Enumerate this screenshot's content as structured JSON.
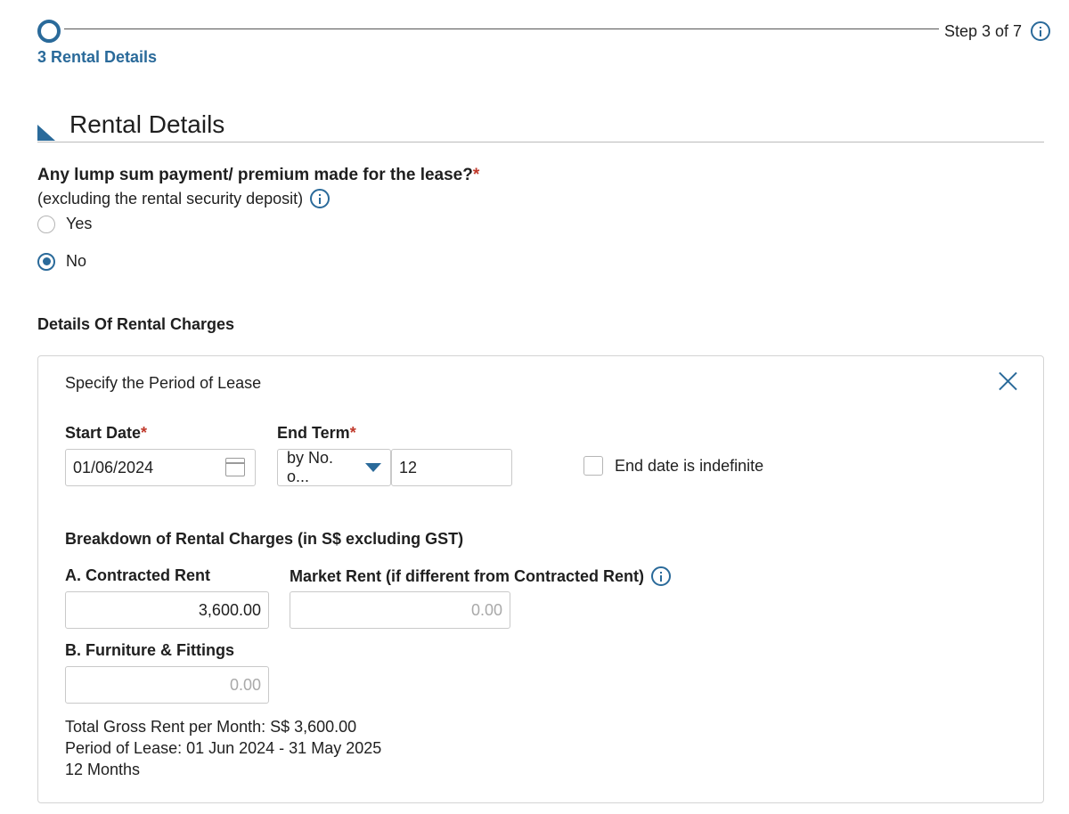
{
  "stepper": {
    "count_label": "Step 3 of 7",
    "step_label": "3 Rental Details"
  },
  "section": {
    "title": "Rental Details"
  },
  "lump_sum": {
    "question": "Any lump sum payment/ premium made for the lease?",
    "required_mark": "*",
    "subtext": "(excluding the rental security deposit)",
    "options": [
      {
        "label": "Yes",
        "selected": false
      },
      {
        "label": "No",
        "selected": true
      }
    ]
  },
  "rental_charges": {
    "heading": "Details Of Rental Charges",
    "panel_title": "Specify the Period of Lease",
    "start_date": {
      "label": "Start Date",
      "required_mark": "*",
      "value": "01/06/2024"
    },
    "end_term": {
      "label": "End Term",
      "required_mark": "*",
      "mode_value": "by No. o...",
      "count_value": "12"
    },
    "indefinite": {
      "label": "End date is indefinite",
      "checked": false
    },
    "breakdown_heading": "Breakdown of Rental Charges (in S$ excluding GST)",
    "contracted_rent": {
      "label": "A. Contracted Rent",
      "value": "3,600.00"
    },
    "market_rent": {
      "label": "Market Rent (if different from Contracted Rent)",
      "placeholder": "0.00"
    },
    "furniture": {
      "label": "B. Furniture & Fittings",
      "placeholder": "0.00"
    },
    "summary": {
      "total_gross": "Total Gross Rent per Month: S$ 3,600.00",
      "period": "Period of Lease: 01 Jun 2024 - 31 May 2025",
      "months": "12 Months"
    }
  },
  "colors": {
    "accent": "#2a6a9a",
    "required": "#c0392b",
    "border": "#c9c9c9"
  },
  "icons": [
    "info-icon",
    "calendar-icon",
    "dropdown-caret-icon",
    "close-icon"
  ]
}
